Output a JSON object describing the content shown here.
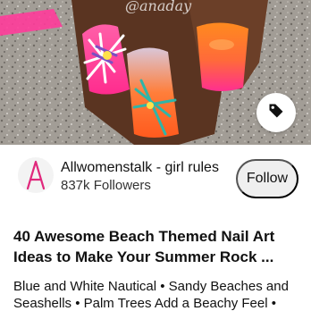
{
  "pin": {
    "image_alt": "Bright pink, orange and tropical flower nail art",
    "watermark": "@anaday"
  },
  "creator": {
    "name": "Allwomenstalk - girl rules",
    "followers": "837k Followers",
    "avatar_letter": "A",
    "follow_label": "Follow"
  },
  "article": {
    "title": "40 Awesome Beach Themed Nail Art Ideas to Make Your Summer Rock ...",
    "description": "Blue and White Nautical • Sandy Beaches and Seashells • Palm Trees Add a Beachy Feel •"
  },
  "colors": {
    "brand": "#e0287c",
    "follow_bg": "#efefef"
  },
  "icons": {
    "tag": "tag-icon"
  }
}
